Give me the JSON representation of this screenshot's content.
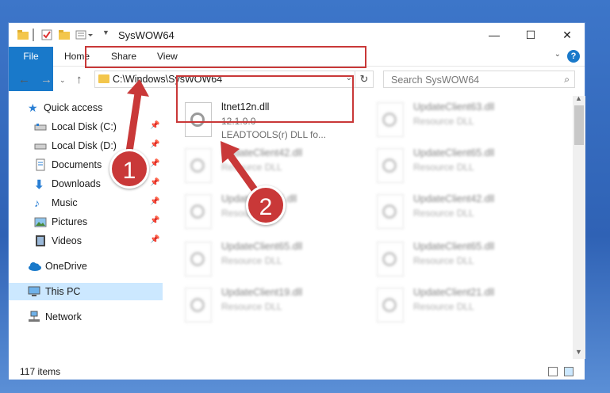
{
  "window": {
    "title": "SysWOW64",
    "minimize": "—",
    "maximize": "☐",
    "close": "✕"
  },
  "ribbon": {
    "tabs": [
      "File",
      "Home",
      "Share",
      "View"
    ],
    "help": "?"
  },
  "address": {
    "path": "C:\\Windows\\SysWOW64",
    "search_placeholder": "Search SysWOW64"
  },
  "sidebar": {
    "items": [
      {
        "label": "Quick access",
        "icon": "star-icon"
      },
      {
        "label": "Local Disk (C:)",
        "icon": "drive-icon",
        "pinned": true
      },
      {
        "label": "Local Disk (D:)",
        "icon": "drive-icon",
        "pinned": true
      },
      {
        "label": "Documents",
        "icon": "documents-icon",
        "pinned": true
      },
      {
        "label": "Downloads",
        "icon": "download-icon",
        "pinned": true
      },
      {
        "label": "Music",
        "icon": "music-icon",
        "pinned": true
      },
      {
        "label": "Pictures",
        "icon": "pictures-icon",
        "pinned": true
      },
      {
        "label": "Videos",
        "icon": "videos-icon",
        "pinned": true
      },
      {
        "label": "OneDrive",
        "icon": "cloud-icon"
      },
      {
        "label": "This PC",
        "icon": "computer-icon",
        "selected": true
      },
      {
        "label": "Network",
        "icon": "network-icon"
      }
    ]
  },
  "files": [
    {
      "name": "ltnet12n.dll",
      "type": "12.1.0.0",
      "extra": "LEADTOOLS(r) DLL fo..."
    },
    {
      "name": "UpdateClient63.dll",
      "type": "Resource DLL"
    },
    {
      "name": "UpdateClient42.dll",
      "type": "Resource DLL"
    },
    {
      "name": "UpdateClient65.dll",
      "type": "Resource DLL"
    },
    {
      "name": "UpdateClient5.dll",
      "type": "Resource DLL"
    },
    {
      "name": "UpdateClient42.dll",
      "type": "Resource DLL"
    },
    {
      "name": "UpdateClient65.dll",
      "type": "Resource DLL"
    },
    {
      "name": "UpdateClient65.dll",
      "type": "Resource DLL"
    },
    {
      "name": "UpdateClient19.dll",
      "type": "Resource DLL"
    },
    {
      "name": "UpdateClient21.dll",
      "type": "Resource DLL"
    }
  ],
  "status": {
    "count": "117 items"
  },
  "annotations": {
    "step1": "1",
    "step2": "2",
    "color": "#c93838"
  }
}
